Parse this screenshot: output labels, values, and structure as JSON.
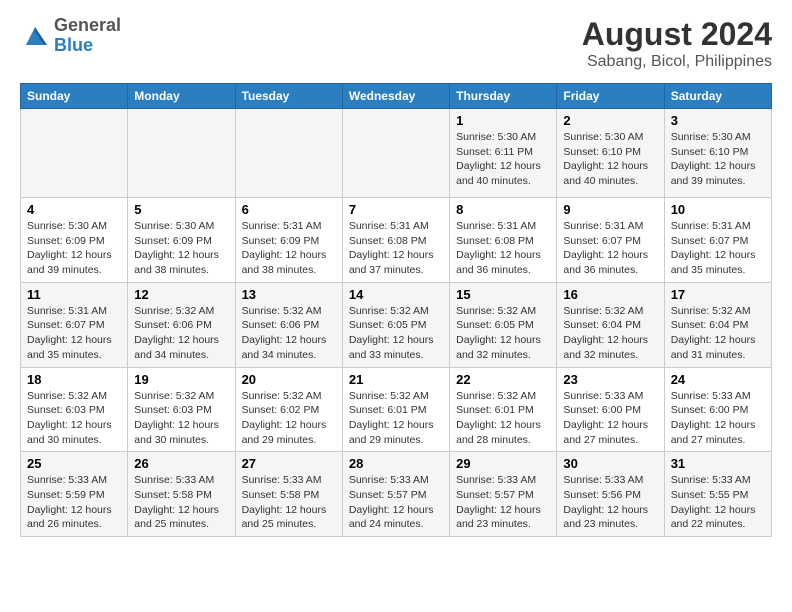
{
  "header": {
    "logo": {
      "general": "General",
      "blue": "Blue"
    },
    "title": "August 2024",
    "subtitle": "Sabang, Bicol, Philippines"
  },
  "weekdays": [
    "Sunday",
    "Monday",
    "Tuesday",
    "Wednesday",
    "Thursday",
    "Friday",
    "Saturday"
  ],
  "weeks": [
    [
      {
        "day": "",
        "info": ""
      },
      {
        "day": "",
        "info": ""
      },
      {
        "day": "",
        "info": ""
      },
      {
        "day": "",
        "info": ""
      },
      {
        "day": "1",
        "info": "Sunrise: 5:30 AM\nSunset: 6:11 PM\nDaylight: 12 hours and 40 minutes."
      },
      {
        "day": "2",
        "info": "Sunrise: 5:30 AM\nSunset: 6:10 PM\nDaylight: 12 hours and 40 minutes."
      },
      {
        "day": "3",
        "info": "Sunrise: 5:30 AM\nSunset: 6:10 PM\nDaylight: 12 hours and 39 minutes."
      }
    ],
    [
      {
        "day": "4",
        "info": "Sunrise: 5:30 AM\nSunset: 6:09 PM\nDaylight: 12 hours and 39 minutes."
      },
      {
        "day": "5",
        "info": "Sunrise: 5:30 AM\nSunset: 6:09 PM\nDaylight: 12 hours and 38 minutes."
      },
      {
        "day": "6",
        "info": "Sunrise: 5:31 AM\nSunset: 6:09 PM\nDaylight: 12 hours and 38 minutes."
      },
      {
        "day": "7",
        "info": "Sunrise: 5:31 AM\nSunset: 6:08 PM\nDaylight: 12 hours and 37 minutes."
      },
      {
        "day": "8",
        "info": "Sunrise: 5:31 AM\nSunset: 6:08 PM\nDaylight: 12 hours and 36 minutes."
      },
      {
        "day": "9",
        "info": "Sunrise: 5:31 AM\nSunset: 6:07 PM\nDaylight: 12 hours and 36 minutes."
      },
      {
        "day": "10",
        "info": "Sunrise: 5:31 AM\nSunset: 6:07 PM\nDaylight: 12 hours and 35 minutes."
      }
    ],
    [
      {
        "day": "11",
        "info": "Sunrise: 5:31 AM\nSunset: 6:07 PM\nDaylight: 12 hours and 35 minutes."
      },
      {
        "day": "12",
        "info": "Sunrise: 5:32 AM\nSunset: 6:06 PM\nDaylight: 12 hours and 34 minutes."
      },
      {
        "day": "13",
        "info": "Sunrise: 5:32 AM\nSunset: 6:06 PM\nDaylight: 12 hours and 34 minutes."
      },
      {
        "day": "14",
        "info": "Sunrise: 5:32 AM\nSunset: 6:05 PM\nDaylight: 12 hours and 33 minutes."
      },
      {
        "day": "15",
        "info": "Sunrise: 5:32 AM\nSunset: 6:05 PM\nDaylight: 12 hours and 32 minutes."
      },
      {
        "day": "16",
        "info": "Sunrise: 5:32 AM\nSunset: 6:04 PM\nDaylight: 12 hours and 32 minutes."
      },
      {
        "day": "17",
        "info": "Sunrise: 5:32 AM\nSunset: 6:04 PM\nDaylight: 12 hours and 31 minutes."
      }
    ],
    [
      {
        "day": "18",
        "info": "Sunrise: 5:32 AM\nSunset: 6:03 PM\nDaylight: 12 hours and 30 minutes."
      },
      {
        "day": "19",
        "info": "Sunrise: 5:32 AM\nSunset: 6:03 PM\nDaylight: 12 hours and 30 minutes."
      },
      {
        "day": "20",
        "info": "Sunrise: 5:32 AM\nSunset: 6:02 PM\nDaylight: 12 hours and 29 minutes."
      },
      {
        "day": "21",
        "info": "Sunrise: 5:32 AM\nSunset: 6:01 PM\nDaylight: 12 hours and 29 minutes."
      },
      {
        "day": "22",
        "info": "Sunrise: 5:32 AM\nSunset: 6:01 PM\nDaylight: 12 hours and 28 minutes."
      },
      {
        "day": "23",
        "info": "Sunrise: 5:33 AM\nSunset: 6:00 PM\nDaylight: 12 hours and 27 minutes."
      },
      {
        "day": "24",
        "info": "Sunrise: 5:33 AM\nSunset: 6:00 PM\nDaylight: 12 hours and 27 minutes."
      }
    ],
    [
      {
        "day": "25",
        "info": "Sunrise: 5:33 AM\nSunset: 5:59 PM\nDaylight: 12 hours and 26 minutes."
      },
      {
        "day": "26",
        "info": "Sunrise: 5:33 AM\nSunset: 5:58 PM\nDaylight: 12 hours and 25 minutes."
      },
      {
        "day": "27",
        "info": "Sunrise: 5:33 AM\nSunset: 5:58 PM\nDaylight: 12 hours and 25 minutes."
      },
      {
        "day": "28",
        "info": "Sunrise: 5:33 AM\nSunset: 5:57 PM\nDaylight: 12 hours and 24 minutes."
      },
      {
        "day": "29",
        "info": "Sunrise: 5:33 AM\nSunset: 5:57 PM\nDaylight: 12 hours and 23 minutes."
      },
      {
        "day": "30",
        "info": "Sunrise: 5:33 AM\nSunset: 5:56 PM\nDaylight: 12 hours and 23 minutes."
      },
      {
        "day": "31",
        "info": "Sunrise: 5:33 AM\nSunset: 5:55 PM\nDaylight: 12 hours and 22 minutes."
      }
    ]
  ]
}
